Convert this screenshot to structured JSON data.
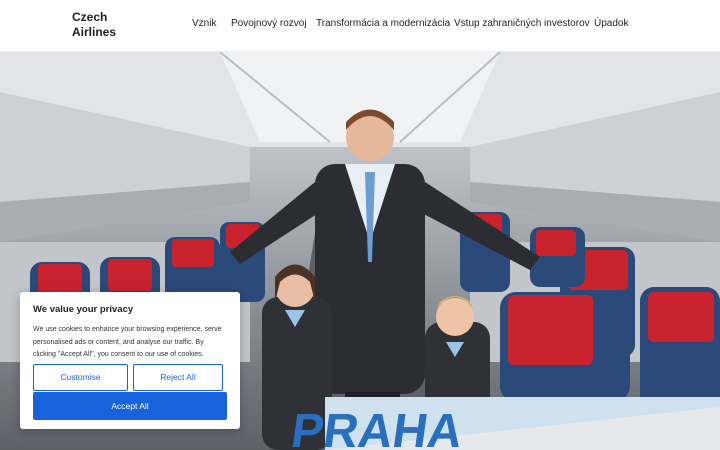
{
  "header": {
    "brand": "Czech\nAirlines",
    "brand_line1": "Czech",
    "brand_line2": "Airlines",
    "nav": [
      {
        "label": "Vznik"
      },
      {
        "label": "Povojnový rozvoj"
      },
      {
        "label": "Transformácia a modernizácia"
      },
      {
        "label": "Vstup zahraničných investorov"
      },
      {
        "label": "Úpadok"
      }
    ]
  },
  "hero": {
    "sign_text": "PRAHA"
  },
  "cookie": {
    "title": "We value your privacy",
    "text": "We use cookies to enhance your browsing experience, serve personalised ads or content, and analyse our traffic. By clicking \"Accept All\", you consent to our use of cookies.",
    "customise_label": "Customise",
    "reject_label": "Reject All",
    "accept_label": "Accept All"
  },
  "colors": {
    "accent": "#1863dc",
    "seat_red": "#c8232f",
    "seat_blue": "#2b4a7a"
  }
}
